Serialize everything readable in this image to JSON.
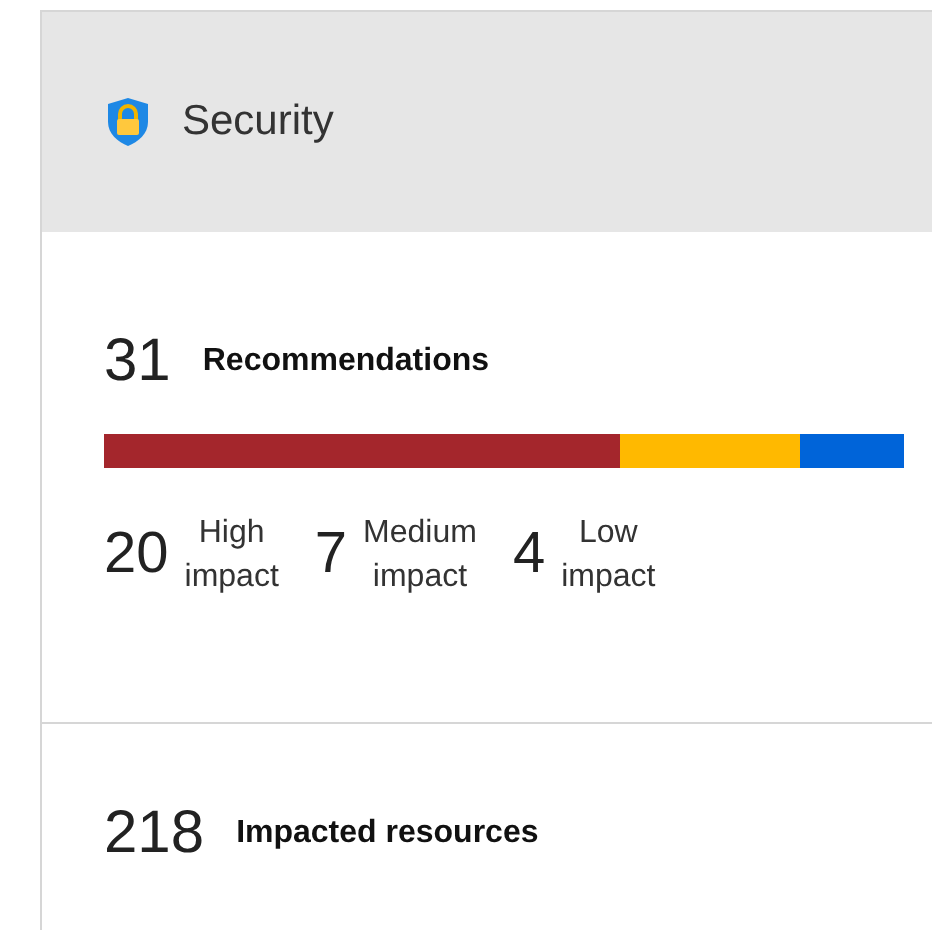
{
  "header": {
    "title": "Security"
  },
  "recommendations": {
    "count": "31",
    "label": "Recommendations",
    "impacts": [
      {
        "count": "20",
        "label": "High impact",
        "color": "#a4262c"
      },
      {
        "count": "7",
        "label": "Medium impact",
        "color": "#ffb900"
      },
      {
        "count": "4",
        "label": "Low impact",
        "color": "#0064d9"
      }
    ]
  },
  "resources": {
    "count": "218",
    "label": "Impacted resources"
  }
}
